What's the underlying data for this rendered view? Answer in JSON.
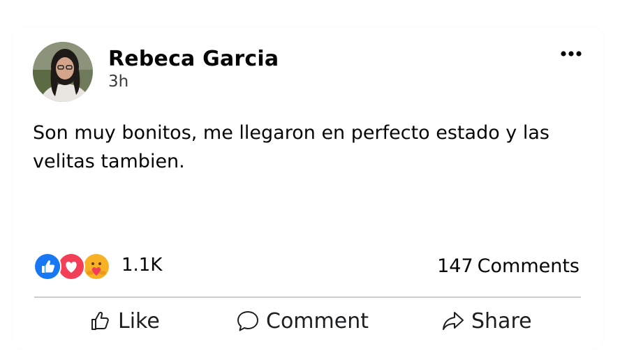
{
  "post": {
    "author": "Rebeca Garcia",
    "time": "3h",
    "text": "Son muy bonitos, me llegaron en perfecto estado y las velitas tambien.",
    "more_icon": "more-horizontal-icon"
  },
  "stats": {
    "reactions": [
      "like",
      "love",
      "care"
    ],
    "reaction_count": "1.1K",
    "comment_count": "147",
    "comment_label": "Comments"
  },
  "actions": {
    "like": {
      "label": "Like",
      "icon": "thumbs-up-icon"
    },
    "comment": {
      "label": "Comment",
      "icon": "speech-bubble-icon"
    },
    "share": {
      "label": "Share",
      "icon": "share-arrow-icon"
    }
  },
  "colors": {
    "like_blue": "#1877f2",
    "love_red": "#f33e58",
    "care_yellow": "#f7b125",
    "divider": "#c9ccd1"
  }
}
